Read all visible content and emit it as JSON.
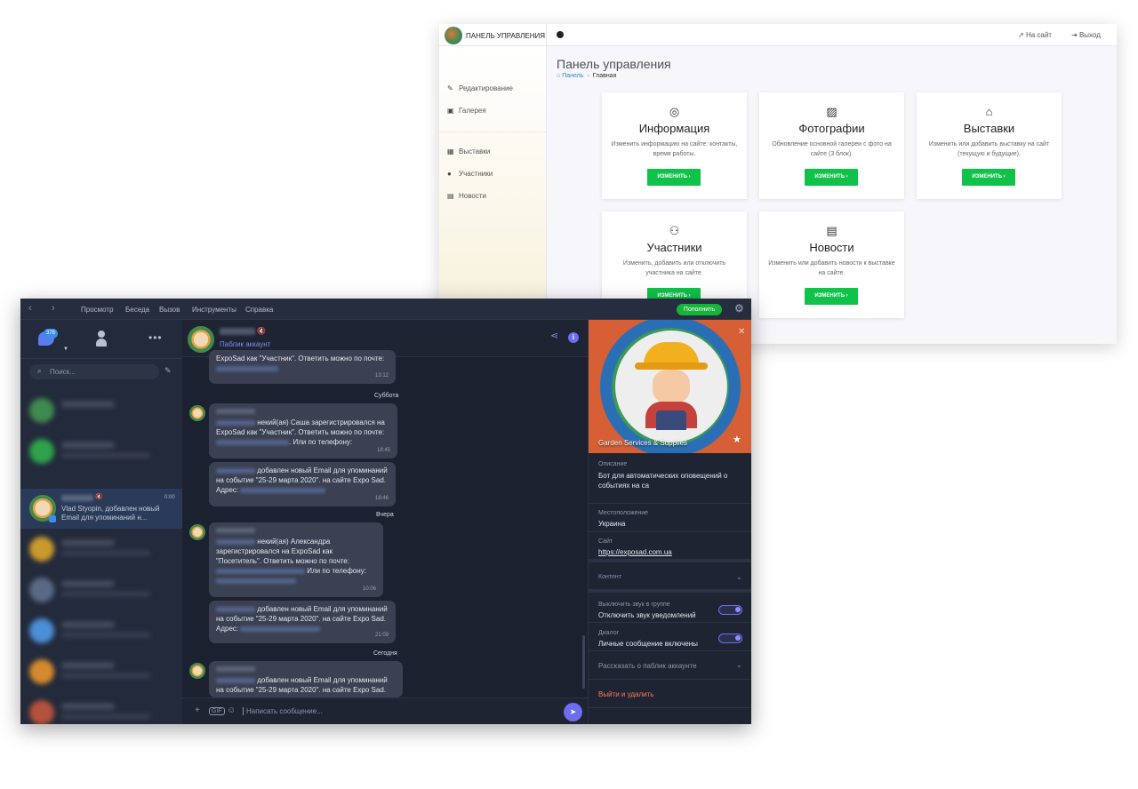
{
  "admin": {
    "brand": "ПАНЕЛЬ УПРАВЛЕНИЯ",
    "top_links": {
      "site": "На сайт",
      "logout": "Выход"
    },
    "sidebar": [
      "Редактирование",
      "Галерея",
      "Выставки",
      "Участники",
      "Новости"
    ],
    "page_title": "Панель управления",
    "breadcrumb": {
      "home": "Панель",
      "current": "Главная"
    },
    "cards": [
      {
        "title": "Информация",
        "desc": "Изменить информацию на сайте: контакты, время работы.",
        "button": "ИЗМЕНИТЬ ›"
      },
      {
        "title": "Фотографии",
        "desc": "Обновление основной галереи с фото на сайте (3 блок).",
        "button": "ИЗМЕНИТЬ ›"
      },
      {
        "title": "Выставки",
        "desc": "Изменить или добавить выставку на сайт (текущую и будущие).",
        "button": "ИЗМЕНИТЬ ›"
      },
      {
        "title": "Участники",
        "desc": "Изменить, добавить или отключить участника на сайте.",
        "button": "ИЗМЕНИТЬ ›"
      },
      {
        "title": "Новости",
        "desc": "Изменить или добавить новости к выставке на сайте.",
        "button": "ИЗМЕНИТЬ ›"
      }
    ]
  },
  "messenger": {
    "menu": [
      "Просмотр",
      "Беседа",
      "Вызов",
      "Инструменты",
      "Справка"
    ],
    "topup": "Пополнить",
    "badge": "378",
    "search_placeholder": "Поиск...",
    "active_chat": {
      "time": "0:00",
      "preview": "Vlad Styopin, добавлен новый Email для упоминаний н..."
    },
    "chat_header_sub": "Паблик аккаунт",
    "messages": [
      {
        "line1": "ExpoSad как \"Участник\". Ответить можно по почте:",
        "time": "13:12"
      },
      {
        "pre": "некий(ая) Саша зарегистрировался на ExpoSad как \"Участник\". Ответить можно по почте:",
        "mid": ". Или по телефону:",
        "time": "18:45"
      },
      {
        "text": "добавлен новый Email для упоминаний на событие \"25-29 марта 2020\". на сайте Expo Sad. Адрес:",
        "time": "18:46"
      },
      {
        "text": "некий(ая) Александра зарегистрировался на ExpoSad как \"Посетитель\". Ответить можно по почте:",
        "mid": "Или по телефону:",
        "time": "10:06"
      },
      {
        "text": "добавлен новый Email для упоминаний на событие \"25-29 марта 2020\". на сайте Expo Sad. Адрес:",
        "time": "21:09"
      },
      {
        "text": "добавлен новый Email для упоминаний на событие \"25-29 марта 2020\". на сайте Expo Sad."
      }
    ],
    "days": {
      "sat": "Суббота",
      "yesterday": "Вчера",
      "today": "Сегодня"
    },
    "composer_placeholder": "Написать сообщение...",
    "profile": {
      "name": "Garden Services & Supplies",
      "desc_label": "Описание",
      "desc": "Бот для автоматических оповещений о событиях на са",
      "loc_label": "Местоположение",
      "loc": "Украина",
      "site_label": "Сайт",
      "site": "https://exposad.com.ua",
      "content": "Контент",
      "mute_label": "Выключить звук в группе",
      "mute_value": "Отключить звук уведомлений",
      "dialog_label": "Диалог",
      "dialog_value": "Личные сообщение включены",
      "tell": "Рассказать о паблик аккаунте",
      "leave": "Выйти и удалить"
    }
  }
}
